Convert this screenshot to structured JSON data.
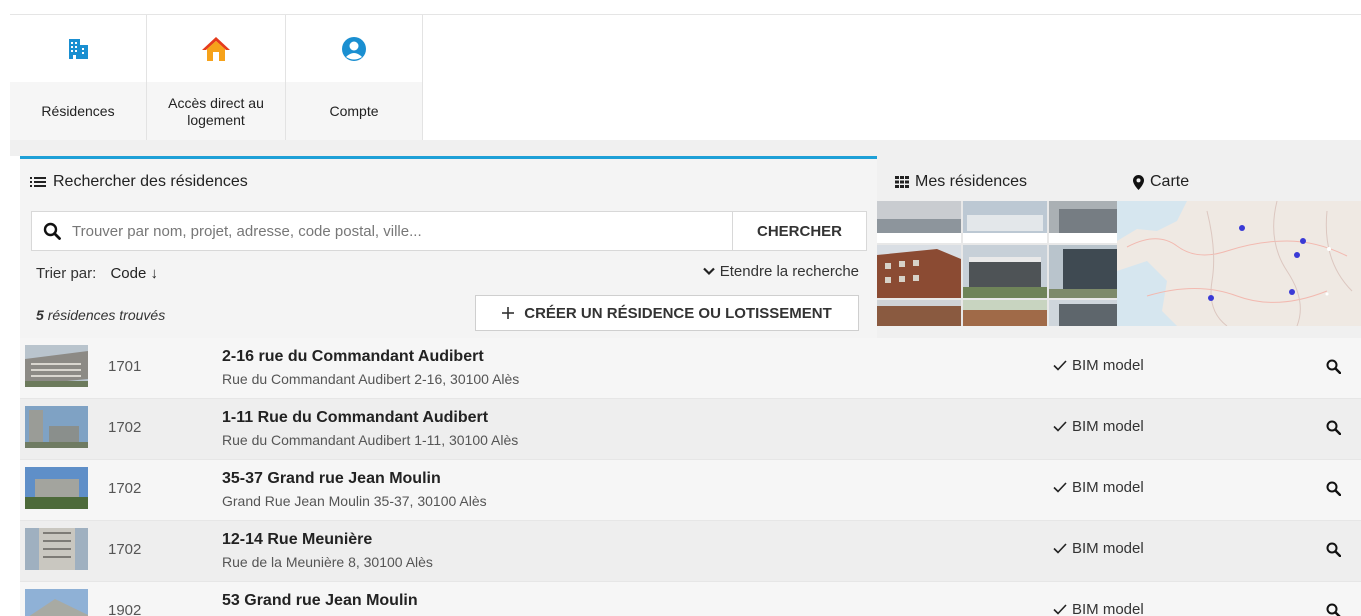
{
  "nav": {
    "items": [
      {
        "label": "Résidences",
        "icon": "building-icon"
      },
      {
        "label": "Accès direct au logement",
        "icon": "house-icon"
      },
      {
        "label": "Compte",
        "icon": "user-circle-icon"
      }
    ]
  },
  "search_panel": {
    "title": "Rechercher des résidences",
    "placeholder": "Trouver par nom, projet, adresse, code postal, ville...",
    "search_button": "CHERCHER",
    "sort_label": "Trier par:",
    "sort_value": "Code ↓",
    "extend_label": "Etendre la recherche",
    "found_count": "5",
    "found_text": "résidences trouvés",
    "create_button": "CRÉER UN RÉSIDENCE OU LOTISSEMENT"
  },
  "tabs": {
    "mes_residences": "Mes résidences",
    "carte": "Carte"
  },
  "colors": {
    "accent": "#1ea0d7",
    "building_icon": "#1a8fd1",
    "house_roof": "#e53b1c",
    "house_body": "#f6a21a",
    "account_icon": "#1a8fd1",
    "map_dot": "#3a3ad6"
  },
  "residences": [
    {
      "code": "1701",
      "name": "2-16 rue du Commandant Audibert",
      "address": "Rue du Commandant Audibert 2-16, 30100 Alès",
      "bim": "BIM model"
    },
    {
      "code": "1702",
      "name": "1-11 Rue du Commandant Audibert",
      "address": "Rue du Commandant Audibert 1-11, 30100 Alès",
      "bim": "BIM model"
    },
    {
      "code": "1702",
      "name": "35-37 Grand rue Jean Moulin",
      "address": "Grand Rue Jean Moulin 35-37, 30100 Alès",
      "bim": "BIM model"
    },
    {
      "code": "1702",
      "name": "12-14 Rue Meunière",
      "address": "Rue de la Meunière 8, 30100 Alès",
      "bim": "BIM model"
    },
    {
      "code": "1902",
      "name": "53 Grand rue Jean Moulin",
      "address": "",
      "bim": "BIM model"
    }
  ]
}
